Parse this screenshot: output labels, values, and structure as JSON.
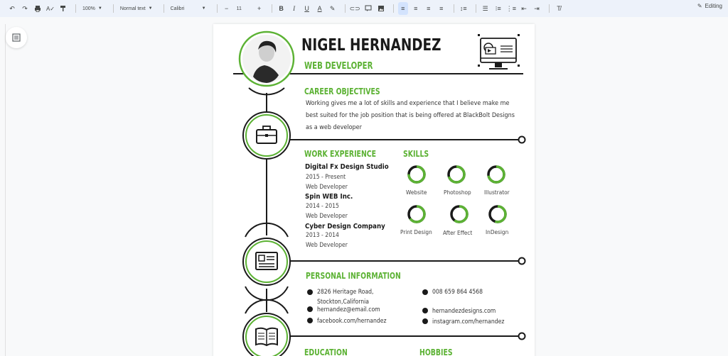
{
  "toolbar": {
    "zoom": "100%",
    "style": "Normal text",
    "font": "Calibri",
    "font_size": "11",
    "mode": "Editing"
  },
  "resume": {
    "name": "NIGEL HERNANDEZ",
    "title": "WEB DEVELOPER",
    "objectives": {
      "heading": "CAREER OBJECTIVES",
      "text": "Working gives me a lot of skills and experience that I believe make me best suited for the job position that is being offered at BlackBolt Designs as a web developer"
    },
    "work": {
      "heading": "WORK EXPERIENCE",
      "jobs": [
        {
          "company": "Digital Fx Design Studio",
          "years": "2015 - Present",
          "role": "Web Developer"
        },
        {
          "company": "Spin WEB Inc.",
          "years": "2014 - 2015",
          "role": "Web Developer"
        },
        {
          "company": "Cyber Design Company",
          "years": "2013 - 2014",
          "role": "Web Developer"
        }
      ]
    },
    "skills": {
      "heading": "SKILLS",
      "items": [
        {
          "label": "Website",
          "level": 0.75
        },
        {
          "label": "Photoshop",
          "level": 0.7
        },
        {
          "label": "Illustrator",
          "level": 0.72
        },
        {
          "label": "Print Design",
          "level": 0.65
        },
        {
          "label": "After Effect",
          "level": 0.6
        },
        {
          "label": "InDesign",
          "level": 0.55
        }
      ]
    },
    "personal": {
      "heading": "PERSONAL INFORMATION",
      "address_line1": "2826 Heritage Road,",
      "address_line2": "Stockton,California",
      "phone": "008 659 864 4568",
      "email": "hernandez@email.com",
      "website": "hernandezdesigns.com",
      "facebook": "facebook.com/hernandez",
      "instagram": "instagram.com/hernandez"
    },
    "education": {
      "heading": "EDUCATION"
    },
    "hobbies": {
      "heading": "HOBBIES"
    }
  },
  "colors": {
    "accent": "#5cb234",
    "ink": "#1a1a1a"
  }
}
